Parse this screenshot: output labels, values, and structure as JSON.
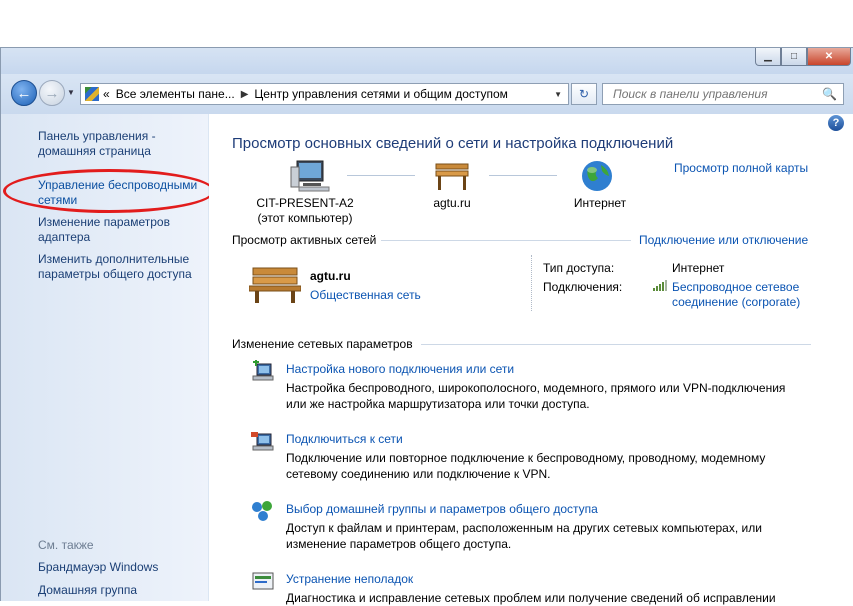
{
  "window": {
    "caption": {
      "minimize": "▁",
      "maximize": "□",
      "close": "✕"
    }
  },
  "nav": {
    "back_icon": "arrow-left-icon",
    "forward_icon": "arrow-right-icon",
    "breadcrumb": {
      "prefix": "«",
      "item1": "Все элементы пане...",
      "separator": "▶",
      "item2": "Центр управления сетями и общим доступом"
    },
    "search_placeholder": "Поиск в панели управления"
  },
  "sidebar": {
    "home": "Панель управления - домашняя страница",
    "wireless": "Управление беспроводными сетями",
    "adapter": "Изменение параметров адаптера",
    "sharing": "Изменить дополнительные параметры общего доступа",
    "see_also": "См. также",
    "firewall": "Брандмауэр Windows",
    "homegroup": "Домашняя группа"
  },
  "main": {
    "title": "Просмотр основных сведений о сети и настройка подключений",
    "full_map": "Просмотр полной карты",
    "map": {
      "computer_name": "CIT-PRESENT-A2",
      "computer_note": "(этот компьютер)",
      "network_name": "agtu.ru",
      "internet": "Интернет"
    },
    "active": {
      "header": "Просмотр активных сетей",
      "connect_link": "Подключение или отключение",
      "network_name": "agtu.ru",
      "network_type": "Общественная сеть",
      "access_label": "Тип доступа:",
      "access_value": "Интернет",
      "connections_label": "Подключения:",
      "connection_value_1": "Беспроводное сетевое",
      "connection_value_2": "соединение (corporate)"
    },
    "change": {
      "header": "Изменение сетевых параметров",
      "tasks": [
        {
          "title": "Настройка нового подключения или сети",
          "desc1": "Настройка беспроводного, широкополосного, модемного, прямого или VPN-подключения",
          "desc2": "или же настройка маршрутизатора или точки доступа."
        },
        {
          "title": "Подключиться к сети",
          "desc1": "Подключение или повторное подключение к беспроводному, проводному, модемному",
          "desc2": "сетевому соединению или подключение к VPN."
        },
        {
          "title": "Выбор домашней группы и параметров общего доступа",
          "desc1": "Доступ к файлам и принтерам, расположенным на других сетевых компьютерах, или",
          "desc2": "изменение параметров общего доступа."
        },
        {
          "title": "Устранение неполадок",
          "desc1": "Диагностика и исправление сетевых проблем или получение сведений об исправлении",
          "desc2": ""
        }
      ]
    }
  },
  "colors": {
    "link": "#0b54b2",
    "title": "#1e3c78",
    "highlight": "#e21c1c"
  }
}
